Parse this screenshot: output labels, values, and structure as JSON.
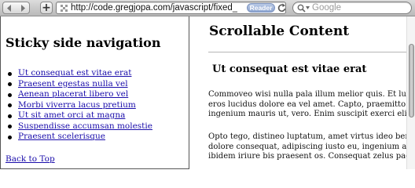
{
  "browser": {
    "url": "http://code.gregjopa.com/javascript/fixed_pc",
    "reader_label": "Reader",
    "search_placeholder": "Google"
  },
  "sidebar": {
    "title": "Sticky side navigation",
    "items": [
      {
        "label": "Ut consequat est vitae erat"
      },
      {
        "label": "Praesent egestas nulla vel"
      },
      {
        "label": "Aenean placerat libero vel"
      },
      {
        "label": "Morbi viverra lacus pretium"
      },
      {
        "label": "Ut sit amet orci at magna"
      },
      {
        "label": "Suspendisse accumsan molestie"
      },
      {
        "label": "Praesent scelerisque"
      }
    ],
    "back_to_top": "Back to Top"
  },
  "content": {
    "title": "Scrollable Content",
    "section_heading": "Ut consequat est vitae erat",
    "paragraph_1": [
      "Commoveo wisi nulla pala illum melior quis. Et lu",
      "eros lucidus dolore ea vel amet. Capto, praemitto s",
      "ingenium mauris ut, vero. Enim suscipit exerci elig"
    ],
    "paragraph_2": [
      "Opto tego, distineo luptatum, amet virtus ideo ben",
      "dolore consequat, adipiscing iusto eu, ingenium au",
      "ibidem iriure bis praesent os. Consequat zelus pag"
    ]
  },
  "colors": {
    "link": "#1a0dab",
    "toolbar": "#c8c8c8",
    "reader_badge": "#9fb3da"
  }
}
